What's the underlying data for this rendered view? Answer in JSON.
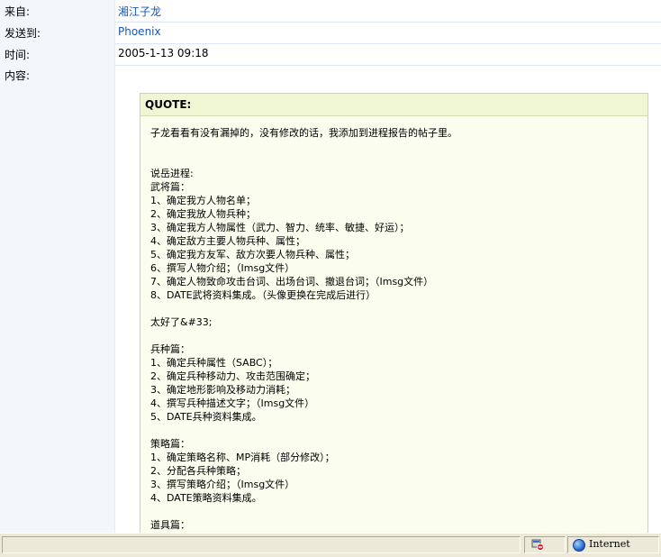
{
  "message": {
    "from_label": "来自:",
    "from_value": "湘江子龙",
    "to_label": "发送到:",
    "to_value": "Phoenix",
    "time_label": "时间:",
    "time_value": "2005-1-13 09:18",
    "content_label": "内容:"
  },
  "quote": {
    "header": "QUOTE:",
    "body": "子龙看看有没有漏掉的，没有修改的话，我添加到进程报告的帖子里。\n\n\n说岳进程:\n武将篇：\n1、确定我方人物名单；\n2、确定我放人物兵种；\n3、确定我方人物属性（武力、智力、统率、敏捷、好运）；\n4、确定敌方主要人物兵种、属性；\n5、确定我方友军、敌方次要人物兵种、属性；\n6、撰写人物介绍；（Imsg文件）\n7、确定人物致命攻击台词、出场台词、撤退台词；（Imsg文件）\n8、DATE武将资料集成。（头像更换在完成后进行）\n\n太好了&#33;\n\n兵种篇：\n1、确定兵种属性（SABC）；\n2、确定兵种移动力、攻击范围确定；\n3、确定地形影响及移动力消耗；\n4、撰写兵种描述文字；（Imsg文件）\n5、DATE兵种资料集成。\n\n策略篇：\n1、确定策略名称、MP消耗（部分修改）；\n2、分配各兵种策略；\n3、撰写策略介绍；（Imsg文件）\n4、DATE策略资料集成。\n\n道具篇："
  },
  "statusbar": {
    "zone": "Internet",
    "security_icon": "blocked-icon",
    "zone_icon": "globe-icon"
  },
  "colors": {
    "link": "#1a56b5",
    "label_bg": "#f2f7fc",
    "quote_bg": "#fbfdee",
    "quote_head_bg": "#f0f5d4"
  }
}
